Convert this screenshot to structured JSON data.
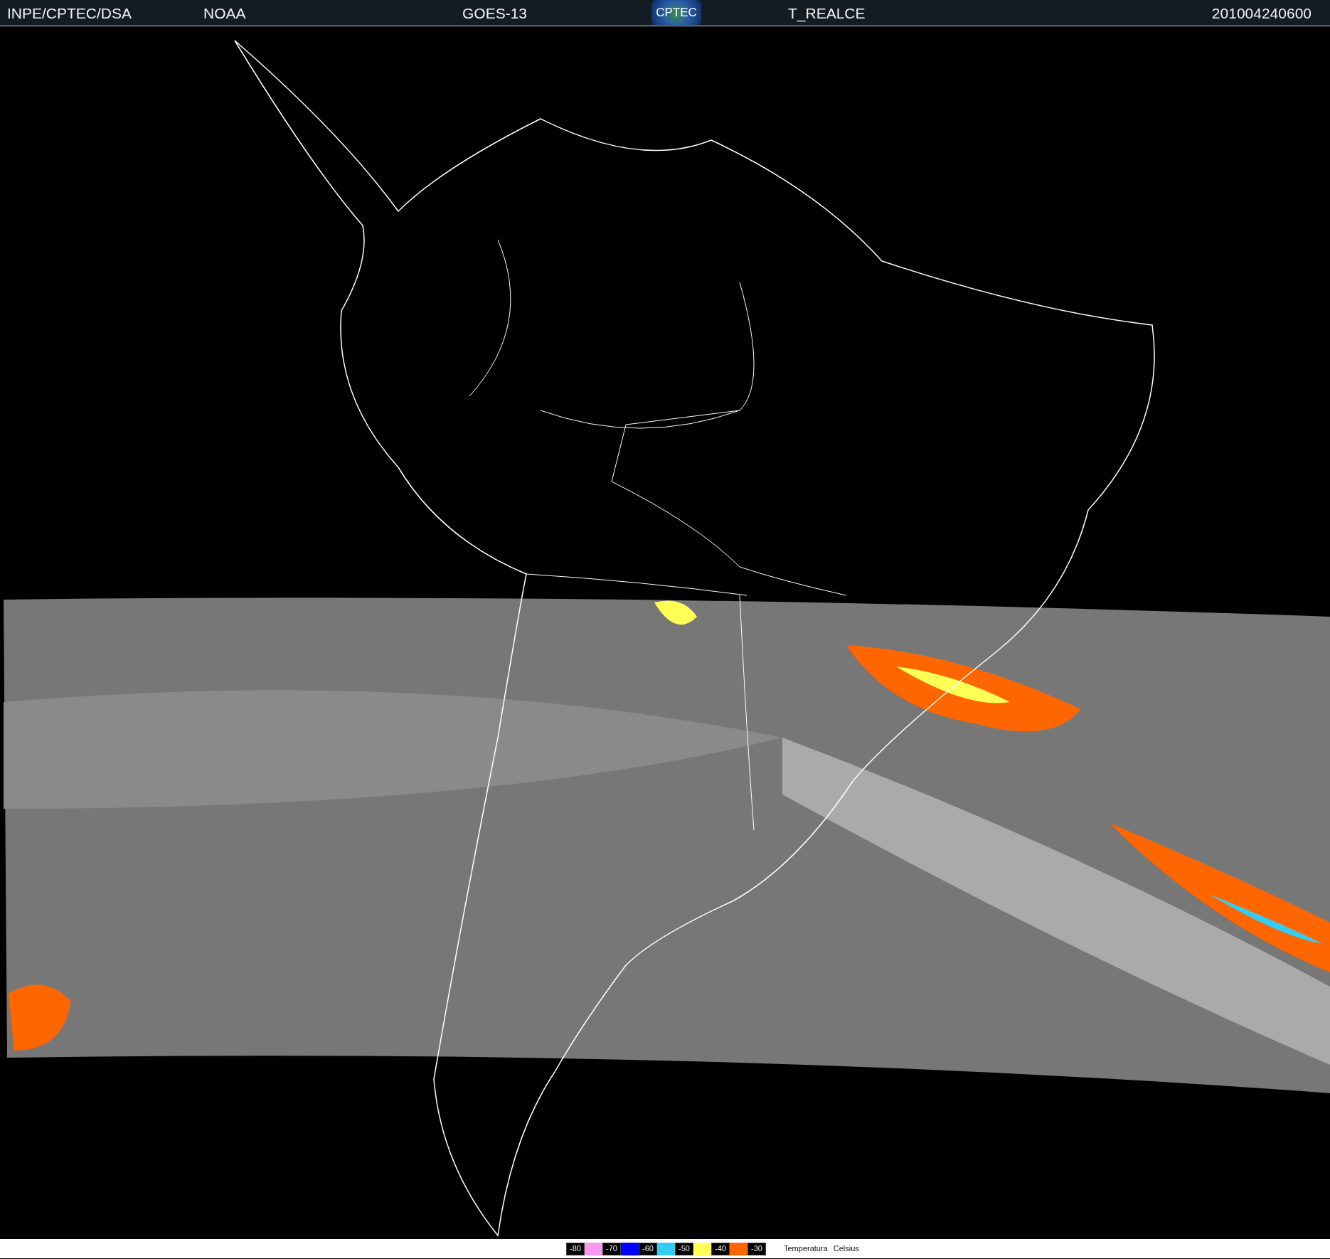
{
  "header": {
    "source": "INPE/CPTEC/DSA",
    "agency": "NOAA",
    "satellite": "GOES-13",
    "logo": "CPTEC",
    "product": "T_REALCE",
    "timestamp": "201004240600"
  },
  "legend": {
    "items": [
      {
        "label": "-80",
        "color": "#f799f0"
      },
      {
        "label": "-70",
        "color": "#0000ff"
      },
      {
        "label": "-60",
        "color": "#33ccf5"
      },
      {
        "label": "-50",
        "color": "#ffff55"
      },
      {
        "label": "-40",
        "color": "#ff6600"
      },
      {
        "label": "-30"
      }
    ],
    "title": "Temperatura",
    "unit": "Celsius"
  }
}
